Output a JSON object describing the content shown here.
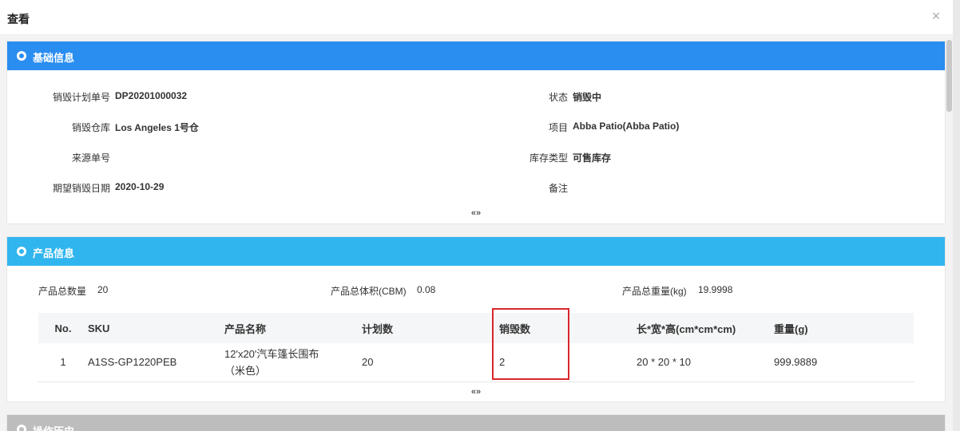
{
  "modal": {
    "title": "查看",
    "close_icon": "×"
  },
  "basic_info": {
    "title": "基础信息",
    "fields": [
      {
        "label": "销毁计划单号",
        "value": "DP20201000032"
      },
      {
        "label": "销毁仓库",
        "value": "Los Angeles 1号仓"
      },
      {
        "label": "来源单号",
        "value": ""
      },
      {
        "label": "期望销毁日期",
        "value": "2020-10-29"
      },
      {
        "label": "状态",
        "value": "销毁中"
      },
      {
        "label": "项目",
        "value": "Abba Patio(Abba Patio)"
      },
      {
        "label": "库存类型",
        "value": "可售库存"
      },
      {
        "label": "备注",
        "value": ""
      }
    ],
    "toggle_icon": "«»"
  },
  "product_info": {
    "title": "产品信息",
    "stats": [
      {
        "label": "产品总数量",
        "value": "20"
      },
      {
        "label": "产品总体积(CBM)",
        "value": "0.08"
      },
      {
        "label": "产品总重量(kg)",
        "value": "19.9998"
      }
    ],
    "columns": [
      "No.",
      "SKU",
      "产品名称",
      "计划数",
      "销毁数",
      "长*宽*高(cm*cm*cm)",
      "重量(g)"
    ],
    "rows": [
      [
        "1",
        "A1SS-GP1220PEB",
        "12'x20'汽车篷长围布（米色）",
        "20",
        "2",
        "20 * 20 * 10",
        "999.9889"
      ]
    ],
    "toggle_icon": "«»"
  },
  "history": {
    "title": "操作历史"
  },
  "colors": {
    "basic_header": "#2a8df0",
    "product_header": "#31b5ef",
    "history_header": "#bdbdbd",
    "highlight": "#d9262c"
  }
}
